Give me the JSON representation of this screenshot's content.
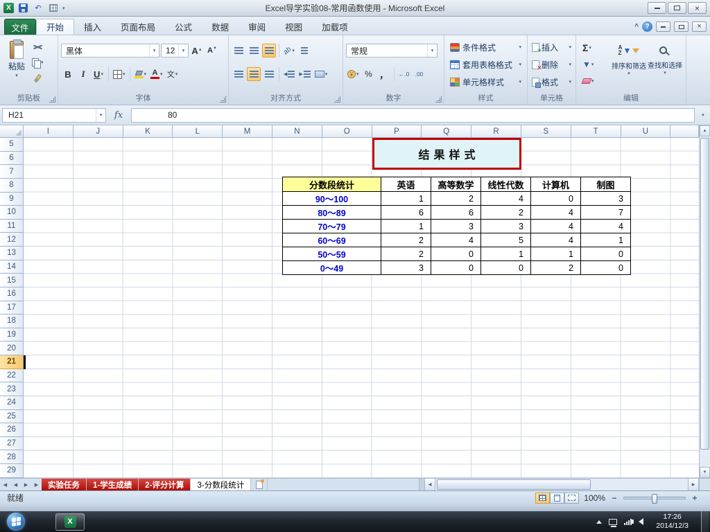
{
  "window": {
    "title": "Excel导学实验08-常用函数使用 - Microsoft Excel"
  },
  "ribbon_tabs": {
    "file": "文件",
    "items": [
      {
        "label": "开始",
        "active": true
      },
      {
        "label": "插入"
      },
      {
        "label": "页面布局"
      },
      {
        "label": "公式"
      },
      {
        "label": "数据"
      },
      {
        "label": "审阅"
      },
      {
        "label": "视图"
      },
      {
        "label": "加载项"
      }
    ]
  },
  "ribbon": {
    "clipboard": {
      "label": "剪贴板",
      "paste": "粘贴"
    },
    "font": {
      "label": "字体",
      "name": "黑体",
      "size": "12",
      "bold": "B",
      "italic": "I",
      "underline": "U",
      "phonetic": "文"
    },
    "alignment": {
      "label": "对齐方式",
      "orientation": "ab"
    },
    "number": {
      "label": "数字",
      "format": "常规",
      "currency": "¥",
      "percent": "%",
      "comma": "，"
    },
    "styles": {
      "label": "样式",
      "items": [
        "条件格式",
        "套用表格格式",
        "单元格样式"
      ]
    },
    "cells": {
      "label": "单元格",
      "items": [
        "插入",
        "删除",
        "格式"
      ]
    },
    "editing": {
      "label": "编辑",
      "autosum": "Σ",
      "sort": "排序和筛选",
      "find": "查找和选择",
      "letters": [
        "A",
        "Z"
      ]
    }
  },
  "formula_bar": {
    "name_box": "H21",
    "fx": "fx",
    "value": "80"
  },
  "grid": {
    "columns": [
      "I",
      "J",
      "K",
      "L",
      "M",
      "N",
      "O",
      "P",
      "Q",
      "R",
      "S",
      "T",
      "U"
    ],
    "rows": [
      5,
      6,
      7,
      8,
      9,
      10,
      11,
      12,
      13,
      14,
      15,
      16,
      17,
      18,
      19,
      20,
      21,
      22,
      23,
      24,
      25,
      26,
      27,
      28,
      29
    ],
    "selected_row": 21,
    "selected_cell": "H21"
  },
  "sheet": {
    "result_box": "结果样式",
    "table": {
      "headers": [
        "分数段统计",
        "英语",
        "高等数学",
        "线性代数",
        "计算机",
        "制图"
      ],
      "rows": [
        {
          "range": "90～100",
          "values": [
            "1",
            "2",
            "4",
            "0",
            "3"
          ]
        },
        {
          "range": "80～89",
          "values": [
            "6",
            "6",
            "2",
            "4",
            "7"
          ]
        },
        {
          "range": "70～79",
          "values": [
            "1",
            "3",
            "3",
            "4",
            "4"
          ]
        },
        {
          "range": "60～69",
          "values": [
            "2",
            "4",
            "5",
            "4",
            "1"
          ]
        },
        {
          "range": "50～59",
          "values": [
            "2",
            "0",
            "1",
            "1",
            "0"
          ]
        },
        {
          "range": "0～49",
          "values": [
            "3",
            "0",
            "0",
            "2",
            "0"
          ]
        }
      ]
    }
  },
  "sheet_tabs": {
    "items": [
      {
        "label": "实验任务",
        "color": "red"
      },
      {
        "label": "1-学生成绩",
        "color": "red"
      },
      {
        "label": "2-评分计算",
        "color": "red"
      },
      {
        "label": "3-分数段统计",
        "active": true
      }
    ]
  },
  "status_bar": {
    "ready": "就绪",
    "zoom": "100%"
  },
  "taskbar": {
    "time": "17:26",
    "date": "2014/12/3"
  },
  "icons": {
    "dropdown": "▾",
    "help": "?",
    "close": "×",
    "chevron_up": "^",
    "undo": "↶",
    "excel": "X",
    "up": "▲",
    "down": "▼",
    "left": "◀",
    "right": "▶",
    "inc_decimal": "←.0",
    "dec_decimal": ".00"
  },
  "colors": {
    "result_border": "#c00000",
    "result_fill": "#e0f4f7",
    "header_yellow": "#ffff99",
    "range_blue": "#0000cc",
    "tab_red": "#c11414",
    "file_tab_green": "#1e7145"
  }
}
